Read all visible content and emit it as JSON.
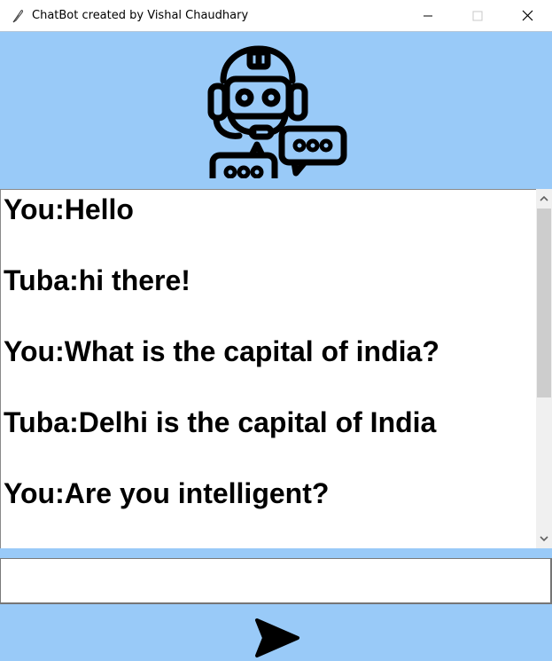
{
  "window": {
    "title": "ChatBot created by Vishal Chaudhary",
    "icon": "feather-icon",
    "controls": [
      "minimize-icon",
      "maximize-icon",
      "close-icon"
    ]
  },
  "header": {
    "icon": "robot-chat-icon",
    "background": "#99caf8"
  },
  "chat": {
    "messages": [
      {
        "text": "You:Hello"
      },
      {
        "text": "Tuba:hi there!"
      },
      {
        "text": "You:What is the capital of india?"
      },
      {
        "text": "Tuba:Delhi is the capital of India"
      },
      {
        "text": "You:Are you intelligent?"
      }
    ]
  },
  "input": {
    "value": "",
    "placeholder": ""
  },
  "footer": {
    "send_icon": "send-arrow-icon"
  }
}
